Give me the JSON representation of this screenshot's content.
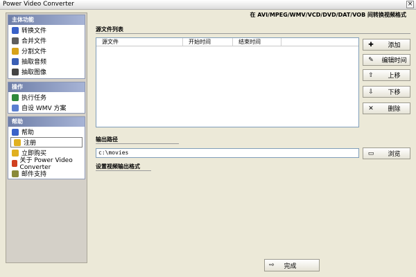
{
  "window": {
    "title": "Power Video Converter"
  },
  "header_note": "在 AVI/MPEG/WMV/VCD/DVD/DAT/VOB 间转换视频格式",
  "sidebar": {
    "sections": [
      {
        "title": "主体功能",
        "items": [
          {
            "label": "转换文件",
            "icon": "convert-icon",
            "color": "#3a62c8"
          },
          {
            "label": "合并文件",
            "icon": "merge-icon",
            "color": "#5e5e5e"
          },
          {
            "label": "分割文件",
            "icon": "split-icon",
            "color": "#d7a21a"
          },
          {
            "label": "抽取音频",
            "icon": "audio-icon",
            "color": "#3a5fb5"
          },
          {
            "label": "抽取图像",
            "icon": "image-icon",
            "color": "#444444"
          }
        ]
      },
      {
        "title": "操作",
        "items": [
          {
            "label": "执行任务",
            "icon": "run-icon",
            "color": "#2f8a3b"
          },
          {
            "label": "自设 WMV 方案",
            "icon": "wmv-icon",
            "color": "#5a7fd0"
          }
        ]
      },
      {
        "title": "帮助",
        "items": [
          {
            "label": "帮助",
            "icon": "help-icon",
            "color": "#3a62c8"
          },
          {
            "label": "注册",
            "icon": "register-icon",
            "color": "#e0b020"
          },
          {
            "label": "立即购买",
            "icon": "buy-icon",
            "color": "#e0b020"
          },
          {
            "label": "关于 Power Video Converter",
            "icon": "home-icon",
            "color": "#d04020"
          },
          {
            "label": "邮件支持",
            "icon": "mail-icon",
            "color": "#8a8a3a"
          }
        ]
      }
    ]
  },
  "main": {
    "source_title": "源文件列表",
    "columns": [
      "源文件",
      "开始时间",
      "结束时间"
    ],
    "buttons": [
      {
        "label": "添加",
        "icon": "plus-icon",
        "glyph": "✚"
      },
      {
        "label": "编辑时间",
        "icon": "edit-icon",
        "glyph": "✎"
      },
      {
        "label": "上移",
        "icon": "up-arrow-icon",
        "glyph": "⇧"
      },
      {
        "label": "下移",
        "icon": "down-arrow-icon",
        "glyph": "⇩"
      },
      {
        "label": "删除",
        "icon": "delete-icon",
        "glyph": "✕"
      }
    ],
    "output_title": "输出路径",
    "output_path": "c:\\movies",
    "browse_label": "浏览",
    "format_title": "设置视频输出格式",
    "finish_label": "完成"
  }
}
